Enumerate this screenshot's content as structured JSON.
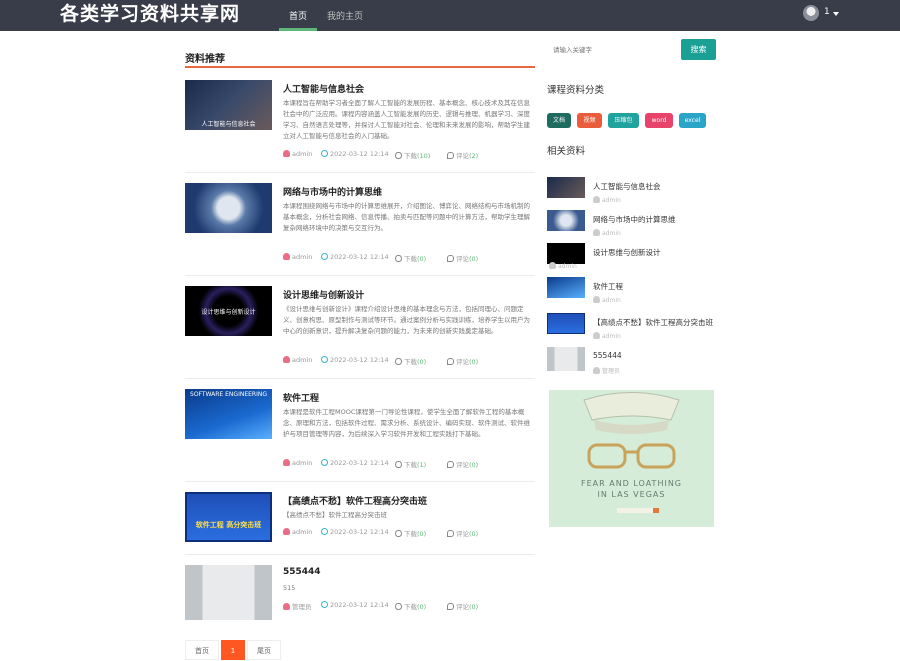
{
  "header": {
    "site_title": "各类学习资料共享网",
    "nav": [
      {
        "label": "首页",
        "active": true
      },
      {
        "label": "我的主页",
        "active": false
      }
    ],
    "user": {
      "name": "1"
    }
  },
  "main": {
    "section_title": "资料推荐",
    "articles": [
      {
        "title": "人工智能与信息社会",
        "thumb_caption": "人工智能与信息社会",
        "desc": "本课程旨在帮助学习者全面了解人工智能的发展历程、基本概念、核心技术及其在信息社会中的广泛应用。课程内容涵盖人工智能发展的历史、逻辑与推理、机器学习、深度学习、自然语言处理等，并探讨人工智能对社会、伦理和未来发展的影响，帮助学生建立对人工智能与信息社会的入门基础。",
        "author": "admin",
        "date": "2022-03-12 12:14",
        "views_label": "下载",
        "views": "(10)",
        "comments_label": "评论",
        "comments": "(2)"
      },
      {
        "title": "网络与市场中的计算思维",
        "thumb_caption": "",
        "desc": "本课程围绕网络与市场中的计算思维展开，介绍图论、博弈论、网络结构与市场机制的基本概念，分析社会网络、信息传播、拍卖与匹配等问题中的计算方法，帮助学生理解复杂网络环境中的决策与交互行为。",
        "author": "admin",
        "date": "2022-03-12 12:14",
        "views_label": "下载",
        "views": "(0)",
        "comments_label": "评论",
        "comments": "(0)"
      },
      {
        "title": "设计思维与创新设计",
        "thumb_caption": "设计思维与创新设计",
        "desc": "《设计思维与创新设计》课程介绍设计思维的基本理念与方法，包括同理心、问题定义、创意构思、原型制作与测试等环节。通过案例分析与实践训练，培养学生以用户为中心的创新意识，提升解决复杂问题的能力，为未来的创新实践奠定基础。",
        "author": "admin",
        "date": "2022-03-12 12:14",
        "views_label": "下载",
        "views": "(0)",
        "comments_label": "评论",
        "comments": "(0)"
      },
      {
        "title": "软件工程",
        "thumb_caption": "SOFTWARE ENGINEERING",
        "desc": "本课程是软件工程MOOC课程第一门导论性课程，使学生全面了解软件工程的基本概念、原理和方法，包括软件过程、需求分析、系统设计、编码实现、软件测试、软件维护与项目管理等内容，为后续深入学习软件开发和工程实践打下基础。",
        "author": "admin",
        "date": "2022-03-12 12:14",
        "views_label": "下载",
        "views": "(1)",
        "comments_label": "评论",
        "comments": "(0)"
      },
      {
        "title": "【高绩点不愁】软件工程高分突击班",
        "thumb_caption": "软件工程 高分突击班",
        "desc": "【高绩点不愁】软件工程高分突击班",
        "author": "admin",
        "date": "2022-03-12 12:14",
        "views_label": "下载",
        "views": "(0)",
        "comments_label": "评论",
        "comments": "(0)"
      },
      {
        "title": "555444",
        "thumb_caption": "",
        "desc": "515",
        "author": "管理员",
        "date": "2022-03-12 12:14",
        "views_label": "下载",
        "views": "(0)",
        "comments_label": "评论",
        "comments": "(0)"
      }
    ],
    "pager": {
      "first": "首页",
      "current": "1",
      "last": "尾页"
    }
  },
  "sidebar": {
    "search": {
      "placeholder": "请输入关键字",
      "button": "搜索"
    },
    "categories_title": "课程资料分类",
    "categories": [
      {
        "label": "文档",
        "color": "#1e6b5f"
      },
      {
        "label": "视频",
        "color": "#e95d3c"
      },
      {
        "label": "压缩包",
        "color": "#20a39e"
      },
      {
        "label": "word",
        "color": "#e8446b"
      },
      {
        "label": "excel",
        "color": "#2aa5c8"
      }
    ],
    "related_title": "相关资料",
    "related": [
      {
        "title": "人工智能与信息社会",
        "author": "admin"
      },
      {
        "title": "网络与市场中的计算思维",
        "author": "admin"
      },
      {
        "title": "设计思维与创新设计",
        "author": "admin"
      },
      {
        "title": "软件工程",
        "author": "admin"
      },
      {
        "title": "【高绩点不愁】软件工程高分突击班",
        "author": "admin"
      },
      {
        "title": "555444",
        "author": "管理员"
      }
    ],
    "ad": {
      "line1": "FEAR AND LOATHING",
      "line2": "IN LAS VEGAS"
    }
  }
}
